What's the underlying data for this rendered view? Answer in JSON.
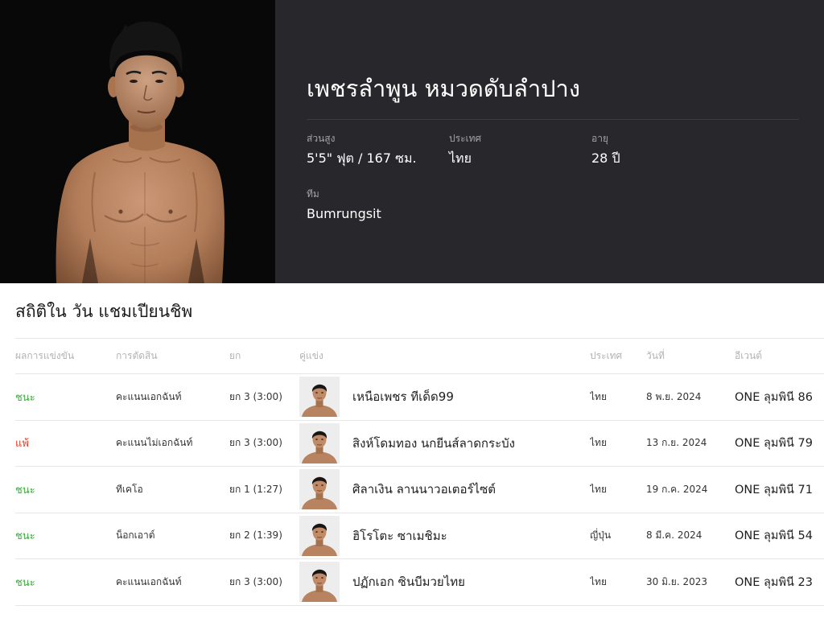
{
  "theme": {
    "photo_background": "#080808",
    "hero_panel": "#28282c",
    "page_background": "#ffffff"
  },
  "fighter": {
    "name": "เพชรลำพูน หมวดดับลำปาง",
    "stats": [
      {
        "label": "ส่วนสูง",
        "value": "5'5\" ฟุต / 167 ซม."
      },
      {
        "label": "ประเทศ",
        "value": "ไทย"
      },
      {
        "label": "อายุ",
        "value": "28 ปี"
      }
    ],
    "team": {
      "label": "ทีม",
      "value": "Bumrungsit"
    }
  },
  "record": {
    "title": "สถิติใน วัน แชมเปียนชิพ",
    "columns": [
      "ผลการแข่งขัน",
      "การตัดสิน",
      "ยก",
      "คู่แข่ง",
      "ประเทศ",
      "วันที่",
      "อีเวนต์"
    ],
    "result_colors": {
      "ชนะ": "#3bab3a",
      "แพ้": "#e2402f"
    },
    "fights": [
      {
        "result": "ชนะ",
        "method": "คะแนนเอกฉันท์",
        "round": "ยก 3 (3:00)",
        "opponent": "เหนือเพชร ทีเด็ด99",
        "country": "ไทย",
        "date": "8 พ.ย. 2024",
        "event": "ONE ลุมพินี 86"
      },
      {
        "result": "แพ้",
        "method": "คะแนนไม่เอกฉันท์",
        "round": "ยก 3 (3:00)",
        "opponent": "สิงห์โดมทอง นกยีนส์ลาดกระบัง",
        "country": "ไทย",
        "date": "13 ก.ย. 2024",
        "event": "ONE ลุมพินี 79"
      },
      {
        "result": "ชนะ",
        "method": "ทีเคโอ",
        "round": "ยก 1 (1:27)",
        "opponent": "ศิลาเงิน ลานนาวอเตอร์ไซต์",
        "country": "ไทย",
        "date": "19 ก.ค. 2024",
        "event": "ONE ลุมพินี 71"
      },
      {
        "result": "ชนะ",
        "method": "น็อกเอาต์",
        "round": "ยก 2 (1:39)",
        "opponent": "ฮิโรโตะ ซาเมชิมะ",
        "country": "ญี่ปุ่น",
        "date": "8 มี.ค. 2024",
        "event": "ONE ลุมพินี 54"
      },
      {
        "result": "ชนะ",
        "method": "คะแนนเอกฉันท์",
        "round": "ยก 3 (3:00)",
        "opponent": "ปฏักเอก ซินบีมวยไทย",
        "country": "ไทย",
        "date": "30 มิ.ย. 2023",
        "event": "ONE ลุมพินี 23"
      }
    ]
  }
}
